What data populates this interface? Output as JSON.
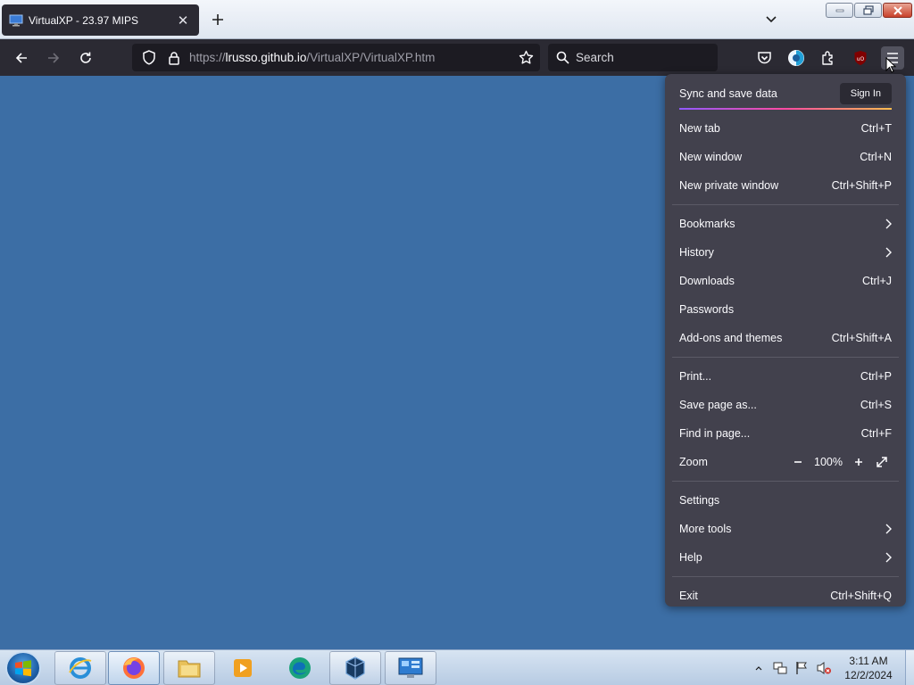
{
  "tab": {
    "title": "VirtualXP - 23.97 MIPS"
  },
  "address_bar": {
    "url_prefix": "https://",
    "url_host": "lrusso.github.io",
    "url_path": "/VirtualXP/VirtualXP.htm"
  },
  "search_bar": {
    "placeholder": "Search"
  },
  "menu": {
    "sync": {
      "label": "Sync and save data",
      "button": "Sign In"
    },
    "group1": [
      {
        "label": "New tab",
        "shortcut": "Ctrl+T"
      },
      {
        "label": "New window",
        "shortcut": "Ctrl+N"
      },
      {
        "label": "New private window",
        "shortcut": "Ctrl+Shift+P"
      }
    ],
    "group2": [
      {
        "label": "Bookmarks",
        "submenu": true
      },
      {
        "label": "History",
        "submenu": true
      },
      {
        "label": "Downloads",
        "shortcut": "Ctrl+J"
      },
      {
        "label": "Passwords"
      },
      {
        "label": "Add-ons and themes",
        "shortcut": "Ctrl+Shift+A"
      }
    ],
    "group3": [
      {
        "label": "Print...",
        "shortcut": "Ctrl+P"
      },
      {
        "label": "Save page as...",
        "shortcut": "Ctrl+S"
      },
      {
        "label": "Find in page...",
        "shortcut": "Ctrl+F"
      }
    ],
    "zoom": {
      "label": "Zoom",
      "value": "100%",
      "minus": "−",
      "plus": "+"
    },
    "group4": [
      {
        "label": "Settings"
      },
      {
        "label": "More tools",
        "submenu": true
      },
      {
        "label": "Help",
        "submenu": true
      }
    ],
    "exit": {
      "label": "Exit",
      "shortcut": "Ctrl+Shift+Q"
    }
  },
  "taskbar": {
    "clock_time": "3:11 AM",
    "clock_date": "12/2/2024",
    "apps": [
      "internet-explorer",
      "firefox",
      "file-explorer",
      "media-player",
      "edge-legacy",
      "virtualbox",
      "control-panel"
    ]
  },
  "colors": {
    "desktop": "#3c6ea5",
    "toolbar": "#2b2a33",
    "menu_bg": "#42414d",
    "urlbar_bg": "#1c1b22"
  }
}
